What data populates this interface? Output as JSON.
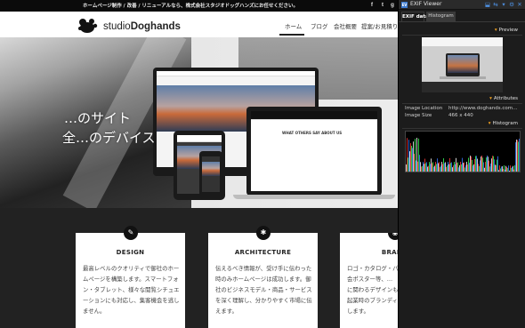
{
  "site": {
    "topbar_text": "ホームページ制作 / 改善 / リニューアルなら、株式会社スタジオドッグハンズにお任せください。",
    "social_icons": [
      "facebook-icon",
      "twitter-icon",
      "google-plus-icon"
    ],
    "logo": {
      "prefix": "studio",
      "brand": "Doghands"
    },
    "nav": [
      "ホーム",
      "ブログ",
      "会社概要",
      "提案/お見積り依頼"
    ],
    "hero_lines": [
      "…のサイト",
      "全…のデバイス"
    ],
    "mockup": {
      "site_heading": "WHAT OTHERS SAY ABOUT US"
    },
    "cards": [
      {
        "title": "DESIGN",
        "icon": "brush-icon",
        "body": "最高レベルのクオリティで御社のホー\nムページを構築します。スマートフォ\nン・タブレット、様々な閲覧シチュエ\nーションにも対応し、集客機会を逃し\nません。"
      },
      {
        "title": "ARCHITECTURE",
        "icon": "gear-icon",
        "body": "伝えるべき情報が、受け手に伝わった\n時のみホームページは成功します。御\n社のビジネスモデル・商品・サービス\nを深く理解し、分かりやすく市場に伝\nえます。"
      },
      {
        "title": "BRAND",
        "icon": "chart-icon",
        "body": "ロゴ・カタログ・パ…\n会ポスター等、…\nに関わるデザインも…\n起業時のブランディ…\nします。"
      }
    ]
  },
  "exif_viewer": {
    "title": "EXIF Viewer",
    "app_icon_text": "EV",
    "tabs": [
      "EXIF data",
      "Histogram"
    ],
    "sections": {
      "preview": "Preview",
      "attributes": "Attributes",
      "histogram": "Histogram"
    },
    "attributes": [
      {
        "key": "Image Location",
        "value": "http://www.doghands.com/w..."
      },
      {
        "key": "Image Size",
        "value": "466 x 440"
      }
    ],
    "colors": {
      "accent": "#f0a020",
      "control_blue": "#4d8fe0"
    }
  }
}
